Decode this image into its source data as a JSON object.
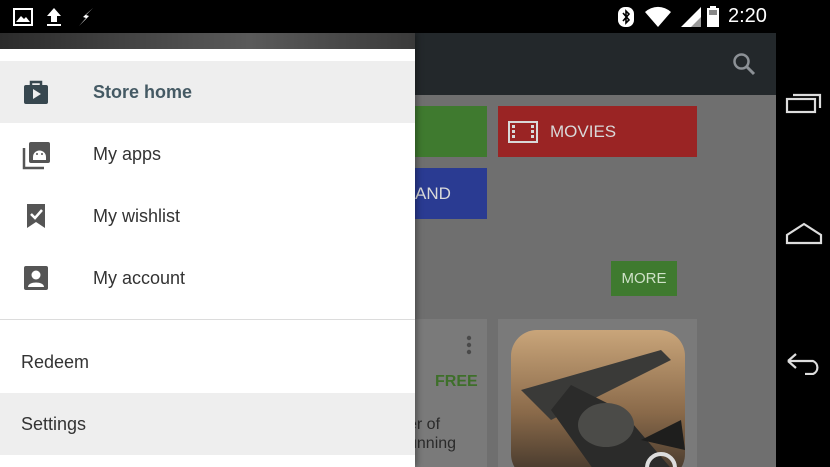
{
  "status_bar": {
    "time": "2:20",
    "left_icons": [
      "image-icon",
      "upload-icon",
      "flash-icon"
    ],
    "right_icons": [
      "bluetooth-icon",
      "wifi-icon",
      "signal-icon",
      "battery-icon"
    ]
  },
  "background": {
    "tiles": {
      "green_label": "",
      "movies_label": "MOVIES",
      "blue_label": "AND"
    },
    "more_label": "MORE",
    "card_left": {
      "price": "FREE",
      "title_line1": "er of",
      "title_line2": "unning"
    }
  },
  "drawer": {
    "nav_items": [
      {
        "label": "Store home",
        "icon": "store-bag-icon"
      },
      {
        "label": "My apps",
        "icon": "apps-library-icon"
      },
      {
        "label": "My wishlist",
        "icon": "wishlist-bookmark-icon"
      },
      {
        "label": "My account",
        "icon": "account-icon"
      }
    ],
    "secondary_items": [
      {
        "label": "Redeem"
      },
      {
        "label": "Settings"
      }
    ]
  },
  "nav_bar": {
    "buttons": [
      "recents-icon",
      "home-icon",
      "back-icon"
    ]
  },
  "colors": {
    "status_bar": "#000000",
    "action_bar": "#23282b",
    "drawer_bg": "#ffffff",
    "selected_item_bg": "#eeeeee",
    "selected_text": "#455a64",
    "free_green": "#3e6f2a"
  }
}
